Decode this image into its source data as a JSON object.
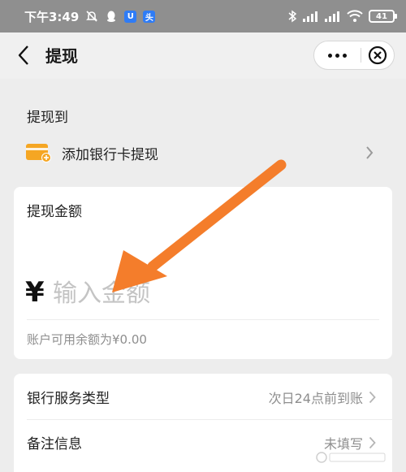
{
  "status_bar": {
    "time": "下午3:49",
    "app_badge_1": "U",
    "app_badge_2": "头",
    "battery": "41"
  },
  "nav": {
    "title": "提现"
  },
  "withdraw_to": {
    "label": "提现到",
    "bank_action": "添加银行卡提现"
  },
  "amount": {
    "title": "提现金额",
    "currency": "¥",
    "placeholder": "输入金额",
    "value": "",
    "balance_text": "账户可用余额为¥0.00"
  },
  "settings": [
    {
      "label": "银行服务类型",
      "value": "次日24点前到账"
    },
    {
      "label": "备注信息",
      "value": "未填写"
    }
  ],
  "colors": {
    "accent_orange": "#f47d2b",
    "card_icon": "#f5a623",
    "status_bar": "#8f8f8f"
  }
}
